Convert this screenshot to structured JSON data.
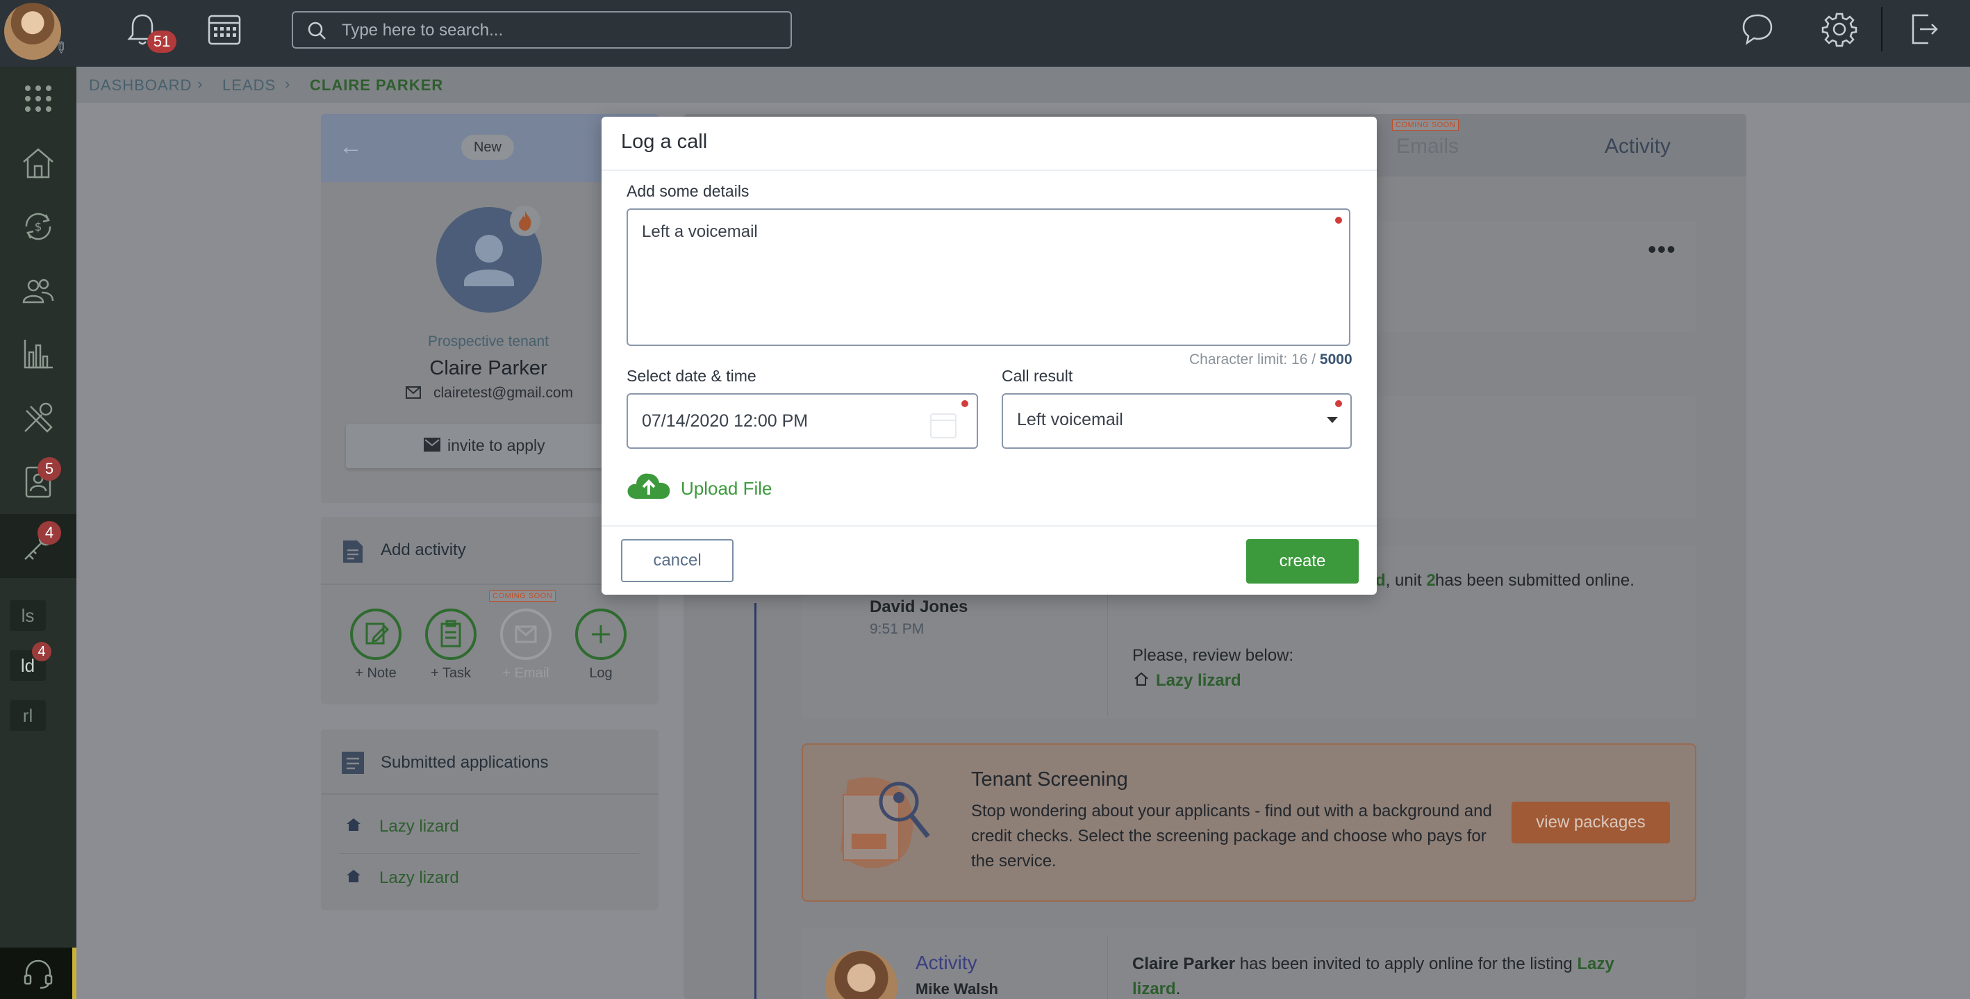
{
  "topbar": {
    "notifications_count": "51",
    "search_placeholder": "Type here to search..."
  },
  "leftnav": {
    "badges": {
      "applications": "5",
      "leads": "4",
      "quick_ld": "4"
    },
    "quick_links": [
      "ls",
      "ld",
      "rl"
    ]
  },
  "breadcrumb": [
    "DASHBOARD",
    "LEADS",
    "CLAIRE PARKER"
  ],
  "profile": {
    "status": "New",
    "role": "Prospective tenant",
    "name": "Claire Parker",
    "email": "clairetest@gmail.com",
    "invite_label": "invite to apply"
  },
  "add_activity": {
    "title": "Add activity",
    "actions": [
      {
        "label": "+ Note",
        "icon": "note-edit-icon",
        "enabled": true
      },
      {
        "label": "+ Task",
        "icon": "clipboard-icon",
        "enabled": true
      },
      {
        "label": "+ Email",
        "icon": "envelope-icon",
        "enabled": false,
        "badge": "COMING SOON"
      },
      {
        "label": "Log",
        "icon": "plus-icon",
        "enabled": true
      }
    ]
  },
  "submitted": {
    "title": "Submitted applications",
    "items": [
      "Lazy lizard",
      "Lazy lizard"
    ]
  },
  "feed": {
    "tabs": {
      "emails": "Emails",
      "emails_badge": "COMING SOON",
      "activity": "Activity"
    },
    "application_entry": {
      "author": "David Jones",
      "time": "9:51 PM",
      "text_pre": "d",
      "text_mid": ", unit ",
      "unit": "2",
      "text_post": " has been submitted online.",
      "review": "Please, review below:",
      "listing": "Lazy lizard"
    },
    "screening": {
      "title": "Tenant Screening",
      "body": "Stop wondering about your applicants - find out with a background and credit checks. Select the screening package and choose who pays for the service.",
      "button": "view packages"
    },
    "activity_entry": {
      "label": "Activity",
      "author": "Mike Walsh",
      "name": "Claire Parker",
      "text": " has been invited to apply online for the listing ",
      "listing_1": "Lazy",
      "listing_2": "lizard",
      "end": "."
    }
  },
  "modal": {
    "title": "Log a call",
    "details_label": "Add some details",
    "details_value": "Left a voicemail",
    "char_limit_prefix": "Character limit: 16 / ",
    "char_limit_max": "5000",
    "date_label": "Select date & time",
    "date_value": "07/14/2020 12:00 PM",
    "result_label": "Call result",
    "result_value": "Left voicemail",
    "upload_label": "Upload File",
    "cancel": "cancel",
    "create": "create"
  },
  "colors": {
    "primary_green": "#3c9a3c",
    "required_dot": "#d33c3c",
    "badge_red": "#b23a3a",
    "screening_orange": "#c87040"
  }
}
